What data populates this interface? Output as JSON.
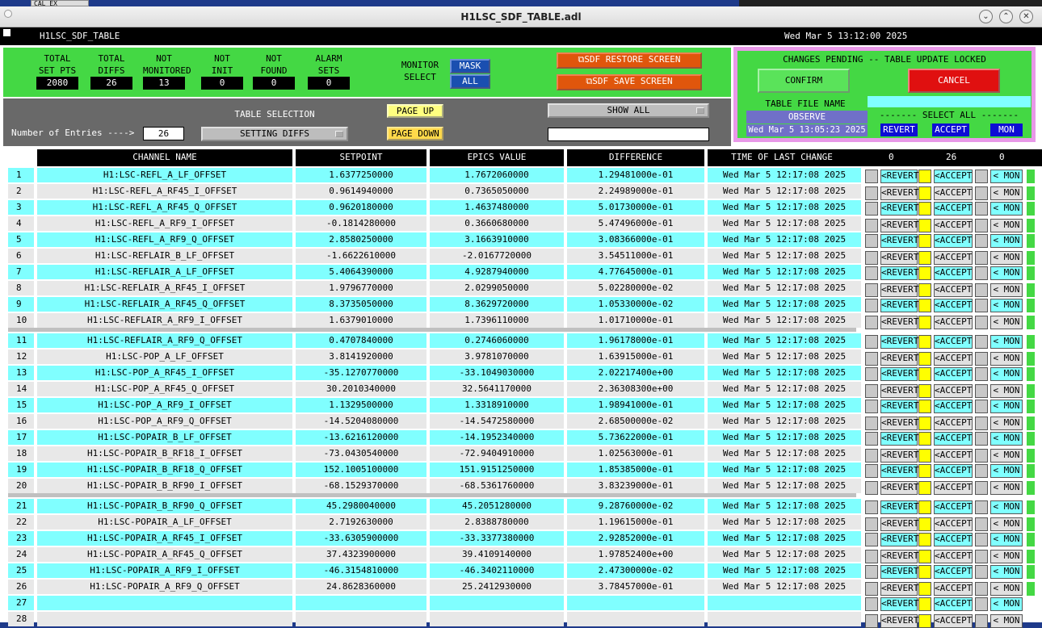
{
  "window": {
    "title": "H1LSC_SDF_TABLE.adl",
    "bg_tab_label": "CAL EX"
  },
  "header": {
    "name": "H1LSC_SDF_TABLE",
    "datetime": "Wed Mar  5 13:12:00 2025"
  },
  "stats": [
    {
      "label1": "TOTAL",
      "label2": "SET PTS",
      "value": "2080"
    },
    {
      "label1": "TOTAL",
      "label2": "DIFFS",
      "value": "26"
    },
    {
      "label1": "NOT",
      "label2": "MONITORED",
      "value": "13"
    },
    {
      "label1": "NOT",
      "label2": "INIT",
      "value": "0"
    },
    {
      "label1": "NOT",
      "label2": "FOUND",
      "value": "0"
    },
    {
      "label1": "ALARM",
      "label2": "SETS",
      "value": "0"
    }
  ],
  "monitor_select": {
    "label1": "MONITOR",
    "label2": "SELECT",
    "mask": "MASK",
    "all": "ALL"
  },
  "buttons": {
    "sdf_restore": "SDF RESTORE SCREEN",
    "sdf_save": "SDF SAVE SCREEN"
  },
  "changes_panel": {
    "status": "CHANGES PENDING -- TABLE UPDATE LOCKED",
    "confirm": "CONFIRM",
    "cancel": "CANCEL",
    "file_name_label": "TABLE FILE NAME",
    "file_name_value": "OBSERVE",
    "file_time": "Wed Mar  5 13:05:23 2025",
    "select_all": "------- SELECT ALL -------",
    "revert": "REVERT",
    "accept": "ACCEPT",
    "mon": "MON"
  },
  "selection": {
    "table_selection_label": "TABLE SELECTION",
    "entries_label": "Number of Entries ---->",
    "entries_value": "26",
    "selection_value": "SETTING DIFFS",
    "page_up": "PAGE UP",
    "page_down": "PAGE DOWN",
    "show_all": "SHOW ALL"
  },
  "columns": {
    "channel": "CHANNEL NAME",
    "setpoint": "SETPOINT",
    "epics": "EPICS VALUE",
    "difference": "DIFFERENCE",
    "time": "TIME OF LAST CHANGE",
    "count_revert": "0",
    "count_accept": "26",
    "count_mon": "0"
  },
  "row_buttons": {
    "revert": "<REVERT",
    "accept": "<ACCEPT",
    "mon": "< MON"
  },
  "rows": [
    {
      "n": "1",
      "ch": "H1:LSC-REFL_A_LF_OFFSET",
      "sp": "1.6377250000",
      "ev": "1.7672060000",
      "diff": "1.29481000e-01",
      "t": "Wed Mar  5 12:17:08 2025"
    },
    {
      "n": "2",
      "ch": "H1:LSC-REFL_A_RF45_I_OFFSET",
      "sp": "0.9614940000",
      "ev": "0.7365050000",
      "diff": "2.24989000e-01",
      "t": "Wed Mar  5 12:17:08 2025"
    },
    {
      "n": "3",
      "ch": "H1:LSC-REFL_A_RF45_Q_OFFSET",
      "sp": "0.9620180000",
      "ev": "1.4637480000",
      "diff": "5.01730000e-01",
      "t": "Wed Mar  5 12:17:08 2025"
    },
    {
      "n": "4",
      "ch": "H1:LSC-REFL_A_RF9_I_OFFSET",
      "sp": "-0.1814280000",
      "ev": "0.3660680000",
      "diff": "5.47496000e-01",
      "t": "Wed Mar  5 12:17:08 2025"
    },
    {
      "n": "5",
      "ch": "H1:LSC-REFL_A_RF9_Q_OFFSET",
      "sp": "2.8580250000",
      "ev": "3.1663910000",
      "diff": "3.08366000e-01",
      "t": "Wed Mar  5 12:17:08 2025"
    },
    {
      "n": "6",
      "ch": "H1:LSC-REFLAIR_B_LF_OFFSET",
      "sp": "-1.6622610000",
      "ev": "-2.0167720000",
      "diff": "3.54511000e-01",
      "t": "Wed Mar  5 12:17:08 2025"
    },
    {
      "n": "7",
      "ch": "H1:LSC-REFLAIR_A_LF_OFFSET",
      "sp": "5.4064390000",
      "ev": "4.9287940000",
      "diff": "4.77645000e-01",
      "t": "Wed Mar  5 12:17:08 2025"
    },
    {
      "n": "8",
      "ch": "H1:LSC-REFLAIR_A_RF45_I_OFFSET",
      "sp": "1.9796770000",
      "ev": "2.0299050000",
      "diff": "5.02280000e-02",
      "t": "Wed Mar  5 12:17:08 2025"
    },
    {
      "n": "9",
      "ch": "H1:LSC-REFLAIR_A_RF45_Q_OFFSET",
      "sp": "8.3735050000",
      "ev": "8.3629720000",
      "diff": "1.05330000e-02",
      "t": "Wed Mar  5 12:17:08 2025"
    },
    {
      "n": "10",
      "ch": "H1:LSC-REFLAIR_A_RF9_I_OFFSET",
      "sp": "1.6379010000",
      "ev": "1.7396110000",
      "diff": "1.01710000e-01",
      "t": "Wed Mar  5 12:17:08 2025"
    },
    {
      "n": "11",
      "ch": "H1:LSC-REFLAIR_A_RF9_Q_OFFSET",
      "sp": "0.4707840000",
      "ev": "0.2746060000",
      "diff": "1.96178000e-01",
      "t": "Wed Mar  5 12:17:08 2025"
    },
    {
      "n": "12",
      "ch": "H1:LSC-POP_A_LF_OFFSET",
      "sp": "3.8141920000",
      "ev": "3.9781070000",
      "diff": "1.63915000e-01",
      "t": "Wed Mar  5 12:17:08 2025"
    },
    {
      "n": "13",
      "ch": "H1:LSC-POP_A_RF45_I_OFFSET",
      "sp": "-35.1270770000",
      "ev": "-33.1049030000",
      "diff": "2.02217400e+00",
      "t": "Wed Mar  5 12:17:08 2025"
    },
    {
      "n": "14",
      "ch": "H1:LSC-POP_A_RF45_Q_OFFSET",
      "sp": "30.2010340000",
      "ev": "32.5641170000",
      "diff": "2.36308300e+00",
      "t": "Wed Mar  5 12:17:08 2025"
    },
    {
      "n": "15",
      "ch": "H1:LSC-POP_A_RF9_I_OFFSET",
      "sp": "1.1329500000",
      "ev": "1.3318910000",
      "diff": "1.98941000e-01",
      "t": "Wed Mar  5 12:17:08 2025"
    },
    {
      "n": "16",
      "ch": "H1:LSC-POP_A_RF9_Q_OFFSET",
      "sp": "-14.5204080000",
      "ev": "-14.5472580000",
      "diff": "2.68500000e-02",
      "t": "Wed Mar  5 12:17:08 2025"
    },
    {
      "n": "17",
      "ch": "H1:LSC-POPAIR_B_LF_OFFSET",
      "sp": "-13.6216120000",
      "ev": "-14.1952340000",
      "diff": "5.73622000e-01",
      "t": "Wed Mar  5 12:17:08 2025"
    },
    {
      "n": "18",
      "ch": "H1:LSC-POPAIR_B_RF18_I_OFFSET",
      "sp": "-73.0430540000",
      "ev": "-72.9404910000",
      "diff": "1.02563000e-01",
      "t": "Wed Mar  5 12:17:08 2025"
    },
    {
      "n": "19",
      "ch": "H1:LSC-POPAIR_B_RF18_Q_OFFSET",
      "sp": "152.1005100000",
      "ev": "151.9151250000",
      "diff": "1.85385000e-01",
      "t": "Wed Mar  5 12:17:08 2025"
    },
    {
      "n": "20",
      "ch": "H1:LSC-POPAIR_B_RF90_I_OFFSET",
      "sp": "-68.1529370000",
      "ev": "-68.5361760000",
      "diff": "3.83239000e-01",
      "t": "Wed Mar  5 12:17:08 2025"
    },
    {
      "n": "21",
      "ch": "H1:LSC-POPAIR_B_RF90_Q_OFFSET",
      "sp": "45.2980040000",
      "ev": "45.2051280000",
      "diff": "9.28760000e-02",
      "t": "Wed Mar  5 12:17:08 2025"
    },
    {
      "n": "22",
      "ch": "H1:LSC-POPAIR_A_LF_OFFSET",
      "sp": "2.7192630000",
      "ev": "2.8388780000",
      "diff": "1.19615000e-01",
      "t": "Wed Mar  5 12:17:08 2025"
    },
    {
      "n": "23",
      "ch": "H1:LSC-POPAIR_A_RF45_I_OFFSET",
      "sp": "-33.6305900000",
      "ev": "-33.3377380000",
      "diff": "2.92852000e-01",
      "t": "Wed Mar  5 12:17:08 2025"
    },
    {
      "n": "24",
      "ch": "H1:LSC-POPAIR_A_RF45_Q_OFFSET",
      "sp": "37.4323900000",
      "ev": "39.4109140000",
      "diff": "1.97852400e+00",
      "t": "Wed Mar  5 12:17:08 2025"
    },
    {
      "n": "25",
      "ch": "H1:LSC-POPAIR_A_RF9_I_OFFSET",
      "sp": "-46.3154810000",
      "ev": "-46.3402110000",
      "diff": "2.47300000e-02",
      "t": "Wed Mar  5 12:17:08 2025"
    },
    {
      "n": "26",
      "ch": "H1:LSC-POPAIR_A_RF9_Q_OFFSET",
      "sp": "24.8628360000",
      "ev": "25.2412930000",
      "diff": "3.78457000e-01",
      "t": "Wed Mar  5 12:17:08 2025"
    },
    {
      "n": "27",
      "ch": "",
      "sp": "",
      "ev": "",
      "diff": "",
      "t": ""
    },
    {
      "n": "28",
      "ch": "",
      "sp": "",
      "ev": "",
      "diff": "",
      "t": ""
    }
  ],
  "colors": {
    "panel_green": "#44d844",
    "row_cyan": "#80ffff",
    "row_gray": "#e8e8e8",
    "orange": "#e0560c",
    "cancel_red": "#e01010"
  }
}
